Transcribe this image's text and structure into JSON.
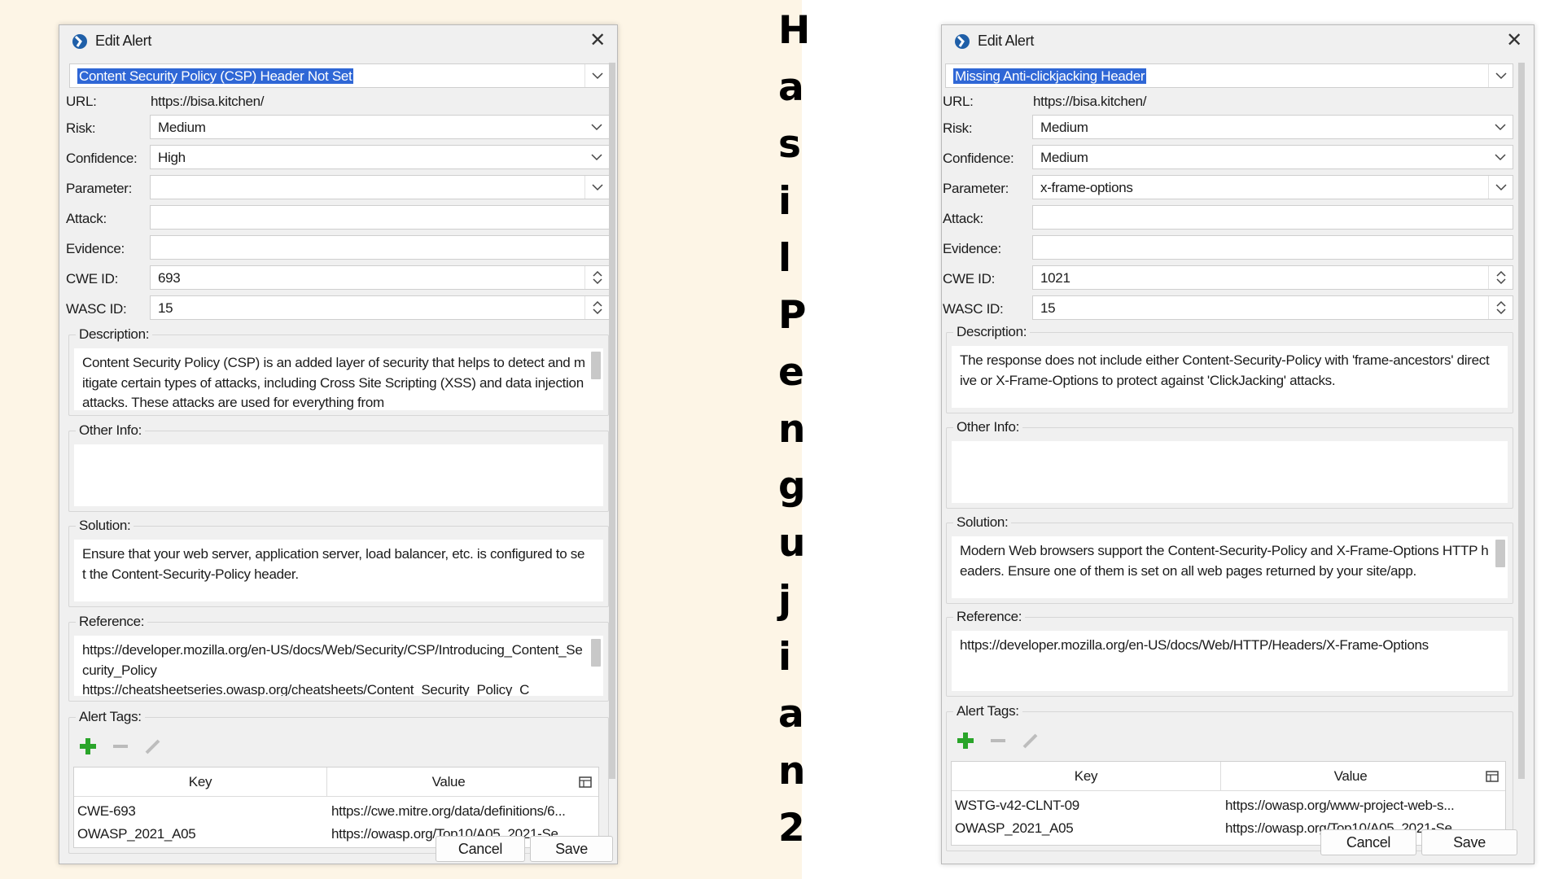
{
  "side_title": [
    "H",
    "a",
    "s",
    "i",
    "l",
    "P",
    "e",
    "n",
    "g",
    "u",
    "j",
    "i",
    "a",
    "n",
    "2"
  ],
  "labels": {
    "url": "URL:",
    "risk": "Risk:",
    "confidence": "Confidence:",
    "parameter": "Parameter:",
    "attack": "Attack:",
    "evidence": "Evidence:",
    "cwe": "CWE ID:",
    "wasc": "WASC ID:",
    "description": "Description:",
    "other_info": "Other Info:",
    "solution": "Solution:",
    "reference": "Reference:",
    "alert_tags": "Alert Tags:",
    "key": "Key",
    "value": "Value",
    "cancel": "Cancel",
    "save": "Save"
  },
  "dialogs": [
    {
      "window_title": "Edit Alert",
      "alert_name": "Content Security Policy (CSP) Header Not Set",
      "url": "https://bisa.kitchen/",
      "risk": "Medium",
      "confidence": "High",
      "parameter": "",
      "attack": "",
      "evidence": "",
      "cwe_id": "693",
      "wasc_id": "15",
      "description": "Content Security Policy (CSP) is an added layer of security that helps to detect and mitigate certain types of attacks, including Cross Site Scripting (XSS) and data injection attacks. These attacks are used for everything from",
      "other_info": "",
      "solution": "Ensure that your web server, application server, load balancer, etc. is configured to set the Content-Security-Policy header.",
      "reference": "https://developer.mozilla.org/en-US/docs/Web/Security/CSP/Introducing_Content_Security_Policy\nhttps://cheatsheetseries.owasp.org/cheatsheets/Content_Security_Policy_C",
      "tags": [
        {
          "key": "CWE-693",
          "value": "https://cwe.mitre.org/data/definitions/6..."
        },
        {
          "key": "OWASP_2021_A05",
          "value": "https://owasp.org/Top10/A05_2021-Se..."
        }
      ]
    },
    {
      "window_title": "Edit Alert",
      "alert_name": "Missing Anti-clickjacking Header",
      "url": "https://bisa.kitchen/",
      "risk": "Medium",
      "confidence": "Medium",
      "parameter": "x-frame-options",
      "attack": "",
      "evidence": "",
      "cwe_id": "1021",
      "wasc_id": "15",
      "description": "The response does not include either Content-Security-Policy with 'frame-ancestors' directive or X-Frame-Options to protect against 'ClickJacking' attacks.",
      "other_info": "",
      "solution": "Modern Web browsers support the Content-Security-Policy and X-Frame-Options HTTP headers. Ensure one of them is set on all web pages returned by your site/app.",
      "reference": "https://developer.mozilla.org/en-US/docs/Web/HTTP/Headers/X-Frame-Options",
      "tags": [
        {
          "key": "WSTG-v42-CLNT-09",
          "value": "https://owasp.org/www-project-web-s..."
        },
        {
          "key": "OWASP_2021_A05",
          "value": "https://owasp.org/Top10/A05_2021-Se..."
        }
      ]
    }
  ]
}
